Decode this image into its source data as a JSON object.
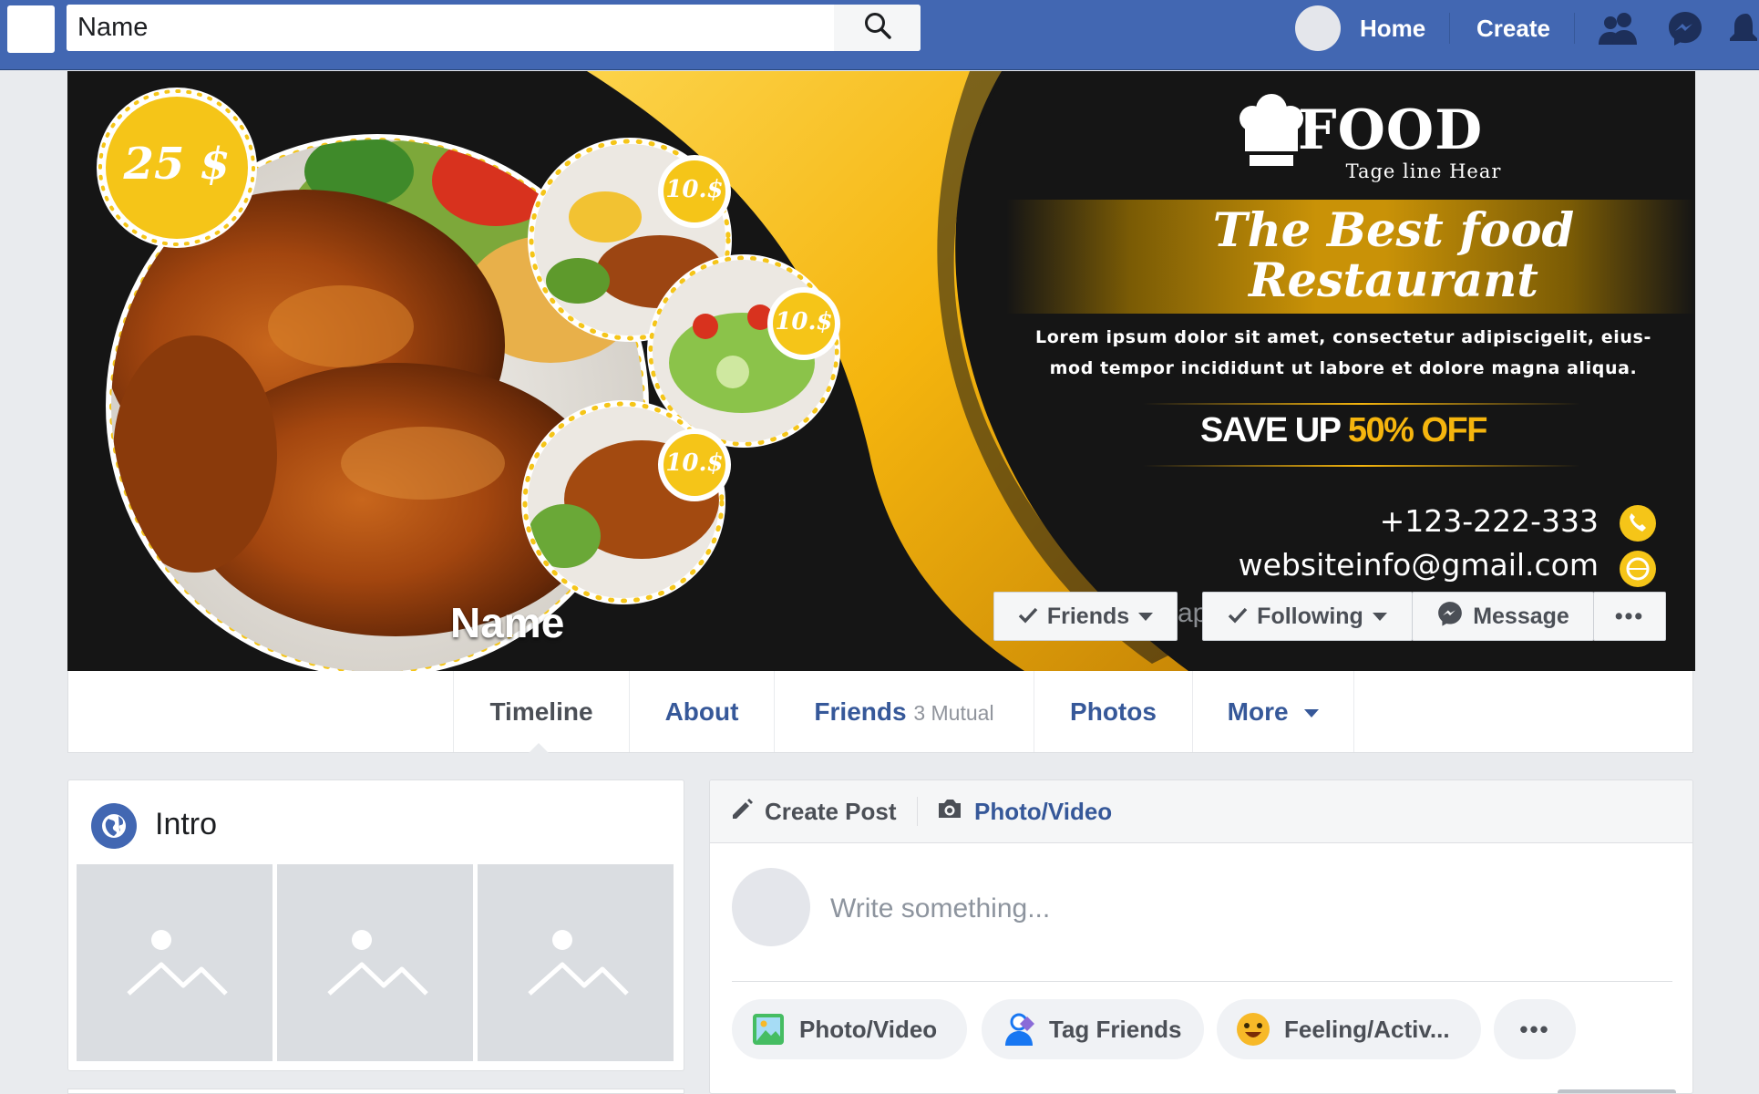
{
  "search": {
    "value": "Name",
    "placeholder": ""
  },
  "nav": {
    "home": "Home",
    "create": "Create"
  },
  "cover": {
    "price_main": "25 $",
    "price_small": [
      "10.$",
      "10.$",
      "10.$"
    ],
    "brand": "FOOD",
    "tagline": "Tage line Hear",
    "headline_1": "The Best food",
    "headline_2": "Restaurant",
    "lorem_1": "Lorem ipsum dolor sit amet, consectetur adipiscigelit, eius-",
    "lorem_2": "mod tempor incididunt ut labore et dolore magna aliqua.",
    "save_prefix": "SAVE UP",
    "save_accent": "50% OFF",
    "phone": "+123-222-333",
    "email": "websiteinfo@gmail.com",
    "profile_name": "Name",
    "overlap_fragment": "ap",
    "colors": {
      "accent": "#f5b50e",
      "dark": "#151515"
    }
  },
  "actions": {
    "friends": "Friends",
    "following": "Following",
    "message": "Message",
    "more": "•••"
  },
  "tabs": [
    {
      "label": "Timeline"
    },
    {
      "label": "About"
    },
    {
      "label": "Friends",
      "sub": "3 Mutual"
    },
    {
      "label": "Photos"
    },
    {
      "label": "More"
    }
  ],
  "intro": {
    "title": "Intro"
  },
  "composer": {
    "create_post": "Create Post",
    "photo_video_tab": "Photo/Video",
    "placeholder": "Write something...",
    "pills": [
      "Photo/Video",
      "Tag Friends",
      "Feeling/Activ...",
      "•••"
    ]
  },
  "icons": {
    "search": "search-icon",
    "friends_nav": "people-icon",
    "messenger": "messenger-icon",
    "notifications": "bell-icon",
    "pencil": "pencil-icon",
    "camera": "camera-icon",
    "globe": "globe-icon",
    "check": "check-icon",
    "chef_hat": "chef-hat-icon",
    "phone": "phone-icon",
    "web": "web-icon"
  },
  "colors": {
    "fb_blue": "#4267b2",
    "link": "#365899",
    "bg": "#e9ebee"
  }
}
